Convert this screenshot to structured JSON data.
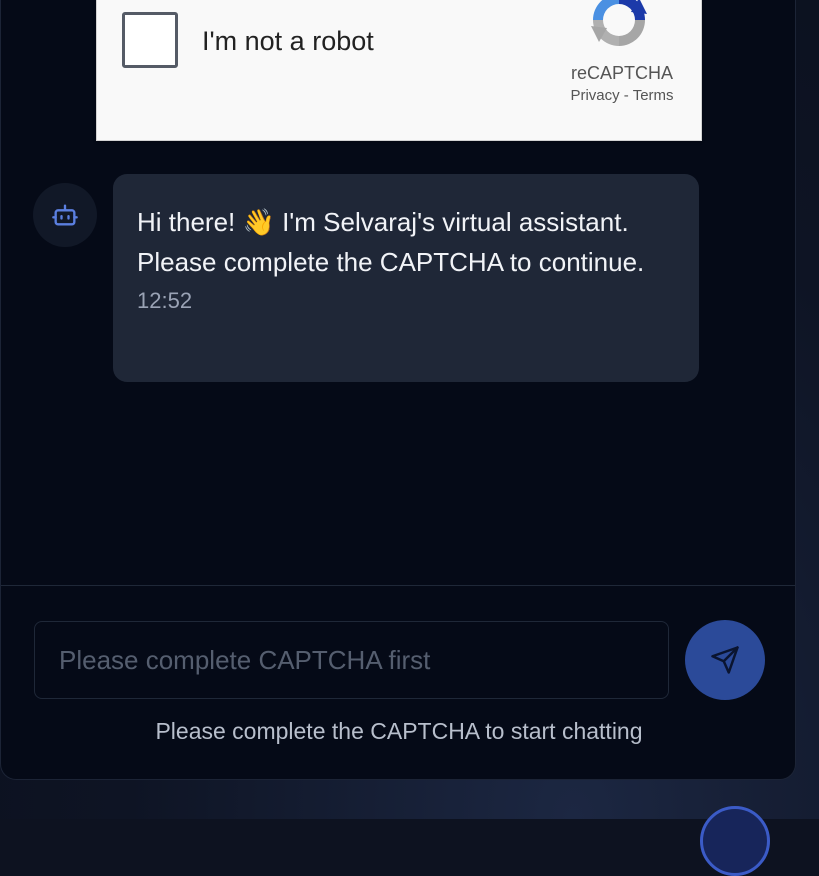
{
  "recaptcha": {
    "checkbox_label": "I'm not a robot",
    "brand": "reCAPTCHA",
    "privacy_link": "Privacy",
    "separator": " - ",
    "terms_link": "Terms"
  },
  "chat": {
    "messages": [
      {
        "sender": "bot",
        "avatar_icon": "robot-icon",
        "text": "Hi there! 👋 I'm Selvaraj's virtual assistant. Please complete the CAPTCHA to continue.",
        "time": "12:52"
      }
    ]
  },
  "composer": {
    "placeholder": "Please complete CAPTCHA first",
    "send_icon": "send-icon",
    "hint": "Please complete the CAPTCHA to start chatting"
  },
  "colors": {
    "panel_bg": "#050a17",
    "bubble_bg": "#1f2737",
    "accent": "#2b4a99",
    "robot_icon": "#5b7fe0"
  }
}
